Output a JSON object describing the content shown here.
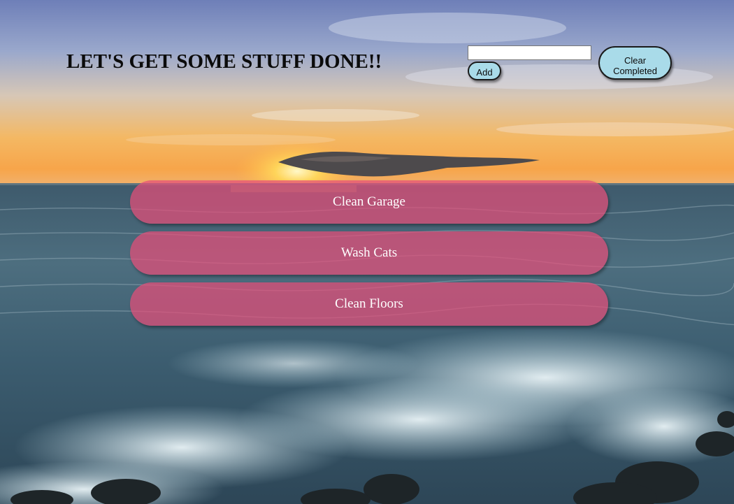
{
  "header": {
    "title": "LET'S GET SOME STUFF DONE!!"
  },
  "controls": {
    "task_input_value": "",
    "task_input_placeholder": "",
    "add_label": "Add",
    "clear_label": "Clear Completed"
  },
  "tasks": [
    {
      "label": "Clean Garage"
    },
    {
      "label": "Wash Cats"
    },
    {
      "label": "Clean Floors"
    }
  ],
  "colors": {
    "task_pill": "#e44e79",
    "button_fill": "#a9dbe9",
    "title_text": "#0b0b0b",
    "task_text": "#ffffff"
  }
}
